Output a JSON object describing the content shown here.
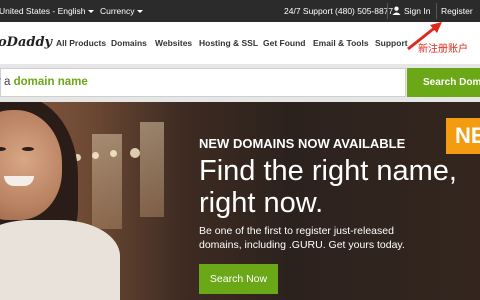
{
  "topbar": {
    "region_label": "United States - English",
    "currency_label": "Currency",
    "support_text": "24/7 Support (480) 505-8877",
    "signin_label": "Sign In",
    "register_label": "Register"
  },
  "nav": {
    "logo_text": "oDaddy",
    "links": [
      "All Products",
      "Domains",
      "Websites",
      "Hosting & SSL",
      "Get Found",
      "Email & Tools",
      "Support"
    ],
    "annotation_text": "新注册账户"
  },
  "search": {
    "placeholder_prefix": "r a ",
    "placeholder_highlight": "domain name",
    "button_label": "Search Domain"
  },
  "hero": {
    "kicker": "NEW DOMAINS NOW AVAILABLE",
    "headline": "Find the right name, right now.",
    "subtext": "Be one of the first to register just-released domains, including .GURU. Get yours today.",
    "cta_label": "Search Now",
    "promo_badge": "NE"
  },
  "colors": {
    "accent_green": "#6ba817",
    "topbar_bg": "#2b2b2b",
    "annotation_red": "#e0281b",
    "promo_orange": "#f39c11"
  },
  "icons": [
    "chevron-down-icon",
    "user-icon",
    "red-arrow-annotation"
  ]
}
